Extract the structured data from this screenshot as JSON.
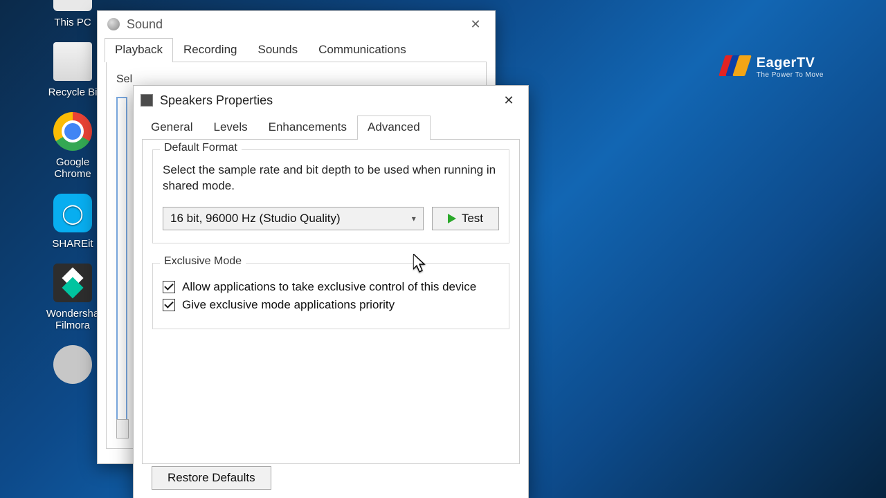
{
  "desktop_icons": {
    "this_pc": "This PC",
    "recycle_bin": "Recycle Bi",
    "chrome": "Google Chrome",
    "shareit": "SHAREit",
    "filmora": "Wondersha Filmora"
  },
  "watermark": {
    "brand": "EagerTV",
    "tagline": "The Power To Move"
  },
  "sound_window": {
    "title": "Sound",
    "tabs": {
      "playback": "Playback",
      "recording": "Recording",
      "sounds": "Sounds",
      "communications": "Communications"
    },
    "body_hint": "Sel"
  },
  "props_window": {
    "title": "Speakers Properties",
    "tabs": {
      "general": "General",
      "levels": "Levels",
      "enhancements": "Enhancements",
      "advanced": "Advanced"
    },
    "default_format": {
      "legend": "Default Format",
      "desc": "Select the sample rate and bit depth to be used when running in shared mode.",
      "selected": "16 bit, 96000 Hz (Studio Quality)",
      "test_label": "Test"
    },
    "exclusive_mode": {
      "legend": "Exclusive Mode",
      "allow": "Allow applications to take exclusive control of this device",
      "priority": "Give exclusive mode applications priority",
      "allow_checked": true,
      "priority_checked": true
    },
    "restore_defaults": "Restore Defaults"
  }
}
